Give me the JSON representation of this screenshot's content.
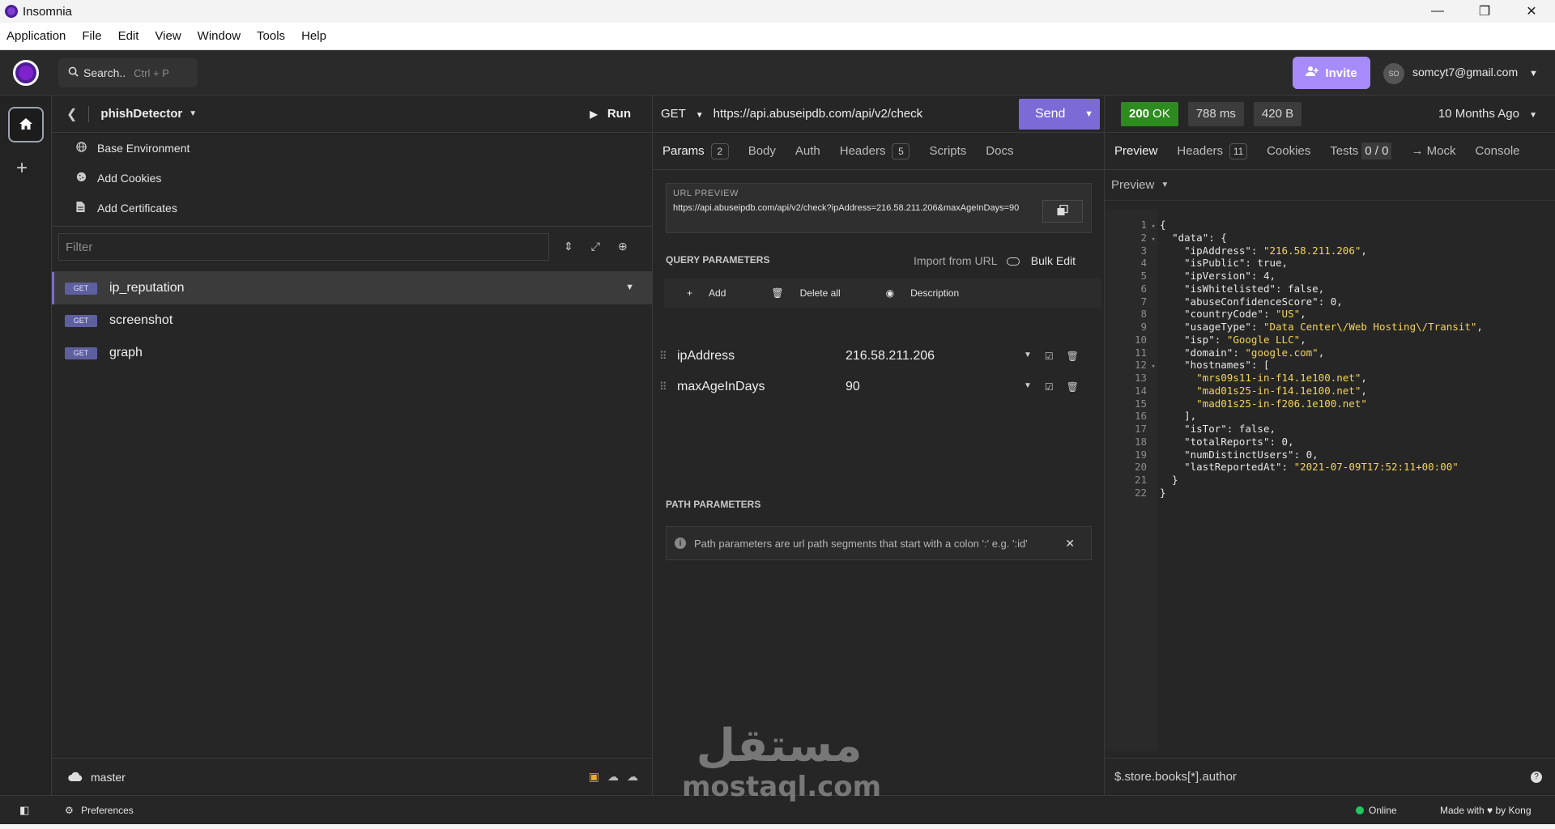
{
  "window": {
    "title": "Insomnia",
    "controls": [
      "—",
      "❐",
      "✕"
    ]
  },
  "menu": [
    "Application",
    "File",
    "Edit",
    "View",
    "Window",
    "Tools",
    "Help"
  ],
  "header": {
    "search_label": "Search..",
    "search_shortcut": "Ctrl + P",
    "invite_label": "Invite",
    "avatar_initials": "SO",
    "user_email": "somcyt7@gmail.com",
    "accent_color": "#a78bfa"
  },
  "sidebar": {
    "project_name": "phishDetector",
    "run_label": "Run",
    "env_items": [
      {
        "label": "Base Environment",
        "icon": "globe-icon"
      },
      {
        "label": "Add Cookies",
        "icon": "cookie-icon"
      },
      {
        "label": "Add Certificates",
        "icon": "certificate-icon"
      }
    ],
    "filter_placeholder": "Filter",
    "requests": [
      {
        "method": "GET",
        "name": "ip_reputation",
        "active": true
      },
      {
        "method": "GET",
        "name": "screenshot",
        "active": false
      },
      {
        "method": "GET",
        "name": "graph",
        "active": false
      }
    ],
    "branch": "master"
  },
  "request": {
    "method": "GET",
    "url": "https://api.abuseipdb.com/api/v2/check",
    "send_label": "Send",
    "tabs": [
      {
        "label": "Params",
        "count": "2"
      },
      {
        "label": "Body"
      },
      {
        "label": "Auth"
      },
      {
        "label": "Headers",
        "count": "5"
      },
      {
        "label": "Scripts"
      },
      {
        "label": "Docs"
      }
    ],
    "url_preview_label": "URL PREVIEW",
    "url_preview": "https://api.abuseipdb.com/api/v2/check?ipAddress=216.58.211.206&maxAgeInDays=90",
    "query_params_label": "QUERY PARAMETERS",
    "import_label": "Import from URL",
    "bulk_edit_label": "Bulk Edit",
    "actions": {
      "add": "Add",
      "delete_all": "Delete all",
      "description": "Description"
    },
    "params": [
      {
        "name": "ipAddress",
        "value": "216.58.211.206"
      },
      {
        "name": "maxAgeInDays",
        "value": "90"
      }
    ],
    "path_params_label": "PATH PARAMETERS",
    "path_params_note": "Path parameters are url path segments that start with a colon ':' e.g. ':id'"
  },
  "response": {
    "status_code": "200",
    "status_text": "OK",
    "time": "788 ms",
    "size": "420 B",
    "when": "10 Months Ago",
    "tabs": [
      {
        "label": "Preview"
      },
      {
        "label": "Headers",
        "count": "11"
      },
      {
        "label": "Cookies"
      },
      {
        "label": "Tests",
        "count": "0 / 0"
      },
      {
        "label": "→ Mock"
      },
      {
        "label": "Console"
      }
    ],
    "preview_mode": "Preview",
    "lines": [
      "{",
      "  \"data\": {",
      "    \"ipAddress\": \"216.58.211.206\",",
      "    \"isPublic\": true,",
      "    \"ipVersion\": 4,",
      "    \"isWhitelisted\": false,",
      "    \"abuseConfidenceScore\": 0,",
      "    \"countryCode\": \"US\",",
      "    \"usageType\": \"Data Center\\/Web Hosting\\/Transit\",",
      "    \"isp\": \"Google LLC\",",
      "    \"domain\": \"google.com\",",
      "    \"hostnames\": [",
      "      \"mrs09s11-in-f14.1e100.net\",",
      "      \"mad01s25-in-f14.1e100.net\",",
      "      \"mad01s25-in-f206.1e100.net\"",
      "    ],",
      "    \"isTor\": false,",
      "    \"totalReports\": 0,",
      "    \"numDistinctUsers\": 0,",
      "    \"lastReportedAt\": \"2021-07-09T17:52:11+00:00\"",
      "  }",
      "}"
    ],
    "jsonpath_placeholder": "$.store.books[*].author"
  },
  "statusbar": {
    "preferences_label": "Preferences",
    "online_label": "Online",
    "made_with": "Made with ♥ by Kong"
  },
  "watermark": {
    "arabic": "مستقل",
    "latin": "mostaql.com"
  }
}
